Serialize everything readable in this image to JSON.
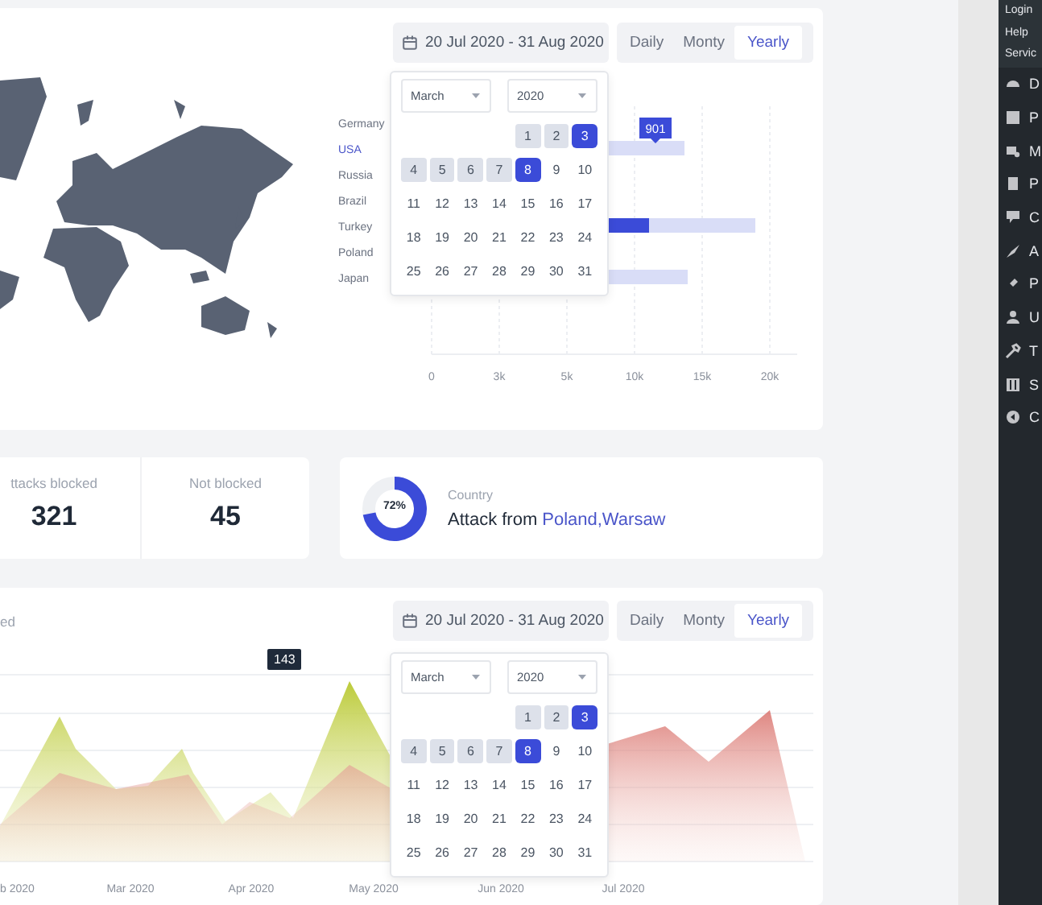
{
  "top_card": {
    "date_range": "20 Jul 2020 - 31 Aug 2020",
    "period_tabs": [
      {
        "label": "Daily",
        "selected": false
      },
      {
        "label": "Monty",
        "selected": false
      },
      {
        "label": "Yearly",
        "selected": true
      }
    ],
    "calendar": {
      "month": "March",
      "year": "2020",
      "weeks": [
        [
          {
            "day": "1",
            "in_range": true,
            "selected": false
          },
          {
            "day": "2",
            "in_range": true,
            "selected": false
          },
          {
            "day": "3",
            "in_range": true,
            "selected": true
          }
        ],
        [
          {
            "day": "4",
            "in_range": true,
            "selected": false
          },
          {
            "day": "5",
            "in_range": true,
            "selected": false
          },
          {
            "day": "6",
            "in_range": true,
            "selected": false
          },
          {
            "day": "7",
            "in_range": true,
            "selected": false
          },
          {
            "day": "8",
            "in_range": true,
            "selected": true
          },
          {
            "day": "9",
            "in_range": false,
            "selected": false
          },
          {
            "day": "10",
            "in_range": false,
            "selected": false
          }
        ],
        [
          {
            "day": "11",
            "in_range": false,
            "selected": false
          },
          {
            "day": "12",
            "in_range": false,
            "selected": false
          },
          {
            "day": "13",
            "in_range": false,
            "selected": false
          },
          {
            "day": "14",
            "in_range": false,
            "selected": false
          },
          {
            "day": "15",
            "in_range": false,
            "selected": false
          },
          {
            "day": "16",
            "in_range": false,
            "selected": false
          },
          {
            "day": "17",
            "in_range": false,
            "selected": false
          }
        ],
        [
          {
            "day": "18",
            "in_range": false,
            "selected": false
          },
          {
            "day": "19",
            "in_range": false,
            "selected": false
          },
          {
            "day": "20",
            "in_range": false,
            "selected": false
          },
          {
            "day": "21",
            "in_range": false,
            "selected": false
          },
          {
            "day": "22",
            "in_range": false,
            "selected": false
          },
          {
            "day": "23",
            "in_range": false,
            "selected": false
          },
          {
            "day": "24",
            "in_range": false,
            "selected": false
          }
        ],
        [
          {
            "day": "25",
            "in_range": false,
            "selected": false
          },
          {
            "day": "26",
            "in_range": false,
            "selected": false
          },
          {
            "day": "27",
            "in_range": false,
            "selected": false
          },
          {
            "day": "28",
            "in_range": false,
            "selected": false
          },
          {
            "day": "29",
            "in_range": false,
            "selected": false
          },
          {
            "day": "30",
            "in_range": false,
            "selected": false
          },
          {
            "day": "31",
            "in_range": false,
            "selected": false
          }
        ]
      ]
    },
    "bar_chart": {
      "categories": [
        {
          "label": "Germany",
          "highlighted": false
        },
        {
          "label": "USA",
          "highlighted": true
        },
        {
          "label": "Russia",
          "highlighted": false
        },
        {
          "label": "Brazil",
          "highlighted": false
        },
        {
          "label": "Turkey",
          "highlighted": false
        },
        {
          "label": "Poland",
          "highlighted": false
        },
        {
          "label": "Japan",
          "highlighted": false
        }
      ],
      "axis_labels": [
        "0",
        "3k",
        "5k",
        "10k",
        "15k",
        "20k"
      ],
      "tooltip": "901"
    }
  },
  "stats": [
    {
      "label": "ttacks blocked",
      "value": "321"
    },
    {
      "label": "Not blocked",
      "value": "45"
    }
  ],
  "location_card": {
    "percent": "72%",
    "caption": "Country",
    "text": "Attack from",
    "place": "Poland,Warsaw"
  },
  "bottom_card": {
    "title": "ed",
    "date_range": "20 Jul 2020 - 31 Aug 2020",
    "period_tabs": [
      {
        "label": "Daily",
        "selected": false
      },
      {
        "label": "Monty",
        "selected": false
      },
      {
        "label": "Yearly",
        "selected": true
      }
    ],
    "tooltip": "143",
    "x_labels": [
      "b 2020",
      "Mar 2020",
      "Apr 2020",
      "May 2020",
      "Jun 2020",
      "Jul 2020"
    ],
    "calendar": {
      "month": "March",
      "year": "2020",
      "weeks": [
        [
          {
            "day": "1",
            "in_range": true,
            "selected": false
          },
          {
            "day": "2",
            "in_range": true,
            "selected": false
          },
          {
            "day": "3",
            "in_range": true,
            "selected": true
          }
        ],
        [
          {
            "day": "4",
            "in_range": true,
            "selected": false
          },
          {
            "day": "5",
            "in_range": true,
            "selected": false
          },
          {
            "day": "6",
            "in_range": true,
            "selected": false
          },
          {
            "day": "7",
            "in_range": true,
            "selected": false
          },
          {
            "day": "8",
            "in_range": true,
            "selected": true
          },
          {
            "day": "9",
            "in_range": false,
            "selected": false
          },
          {
            "day": "10",
            "in_range": false,
            "selected": false
          }
        ],
        [
          {
            "day": "11",
            "in_range": false,
            "selected": false
          },
          {
            "day": "12",
            "in_range": false,
            "selected": false
          },
          {
            "day": "13",
            "in_range": false,
            "selected": false
          },
          {
            "day": "14",
            "in_range": false,
            "selected": false
          },
          {
            "day": "15",
            "in_range": false,
            "selected": false
          },
          {
            "day": "16",
            "in_range": false,
            "selected": false
          },
          {
            "day": "17",
            "in_range": false,
            "selected": false
          }
        ],
        [
          {
            "day": "18",
            "in_range": false,
            "selected": false
          },
          {
            "day": "19",
            "in_range": false,
            "selected": false
          },
          {
            "day": "20",
            "in_range": false,
            "selected": false
          },
          {
            "day": "21",
            "in_range": false,
            "selected": false
          },
          {
            "day": "22",
            "in_range": false,
            "selected": false
          },
          {
            "day": "23",
            "in_range": false,
            "selected": false
          },
          {
            "day": "24",
            "in_range": false,
            "selected": false
          }
        ],
        [
          {
            "day": "25",
            "in_range": false,
            "selected": false
          },
          {
            "day": "26",
            "in_range": false,
            "selected": false
          },
          {
            "day": "27",
            "in_range": false,
            "selected": false
          },
          {
            "day": "28",
            "in_range": false,
            "selected": false
          },
          {
            "day": "29",
            "in_range": false,
            "selected": false
          },
          {
            "day": "30",
            "in_range": false,
            "selected": false
          },
          {
            "day": "31",
            "in_range": false,
            "selected": false
          }
        ]
      ]
    }
  },
  "sidebar": {
    "top_links": [
      "Login",
      "Help",
      "Servic"
    ],
    "items": [
      {
        "label": "D"
      },
      {
        "label": "P"
      },
      {
        "label": "M"
      },
      {
        "label": "P"
      },
      {
        "label": "C"
      },
      {
        "label": "A"
      },
      {
        "label": "P"
      },
      {
        "label": "U"
      },
      {
        "label": "T"
      },
      {
        "label": "S"
      },
      {
        "label": "C"
      }
    ]
  }
}
